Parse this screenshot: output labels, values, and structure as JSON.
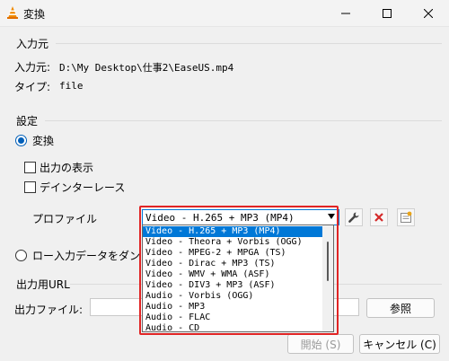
{
  "window": {
    "title": "変換",
    "controls": {
      "minimize": "minimize-icon",
      "maximize": "maximize-icon",
      "close": "close-icon"
    }
  },
  "source": {
    "group_label": "入力元",
    "source_label": "入力元:",
    "source_value": "D:\\My Desktop\\仕事2\\EaseUS.mp4",
    "type_label": "タイプ:",
    "type_value": "file"
  },
  "settings": {
    "group_label": "設定",
    "convert_label": "変換",
    "show_output_label": "出力の表示",
    "deinterlace_label": "デインターレース",
    "profile_label": "プロファイル",
    "profile_selected": "Video - H.265 + MP3 (MP4)",
    "profile_options": [
      "Video - H.265 + MP3 (MP4)",
      "Video - Theora + Vorbis (OGG)",
      "Video - MPEG-2 + MPGA (TS)",
      "Video - Dirac + MP3 (TS)",
      "Video - WMV + WMA (ASF)",
      "Video - DIV3 + MP3 (ASF)",
      "Audio - Vorbis (OGG)",
      "Audio - MP3",
      "Audio - FLAC",
      "Audio - CD"
    ],
    "raw_dump_label": "ロー入力データをダン"
  },
  "output": {
    "group_label": "出力用URL",
    "file_label": "出力ファイル:",
    "file_value": "",
    "browse_label": "参照"
  },
  "footer": {
    "start_label": "開始 (S)",
    "cancel_label": "キャンセル (C)"
  },
  "colors": {
    "accent": "#005fb8",
    "selection": "#0078d7",
    "highlight_border": "#e12424",
    "delete_icon": "#d42a2a"
  }
}
